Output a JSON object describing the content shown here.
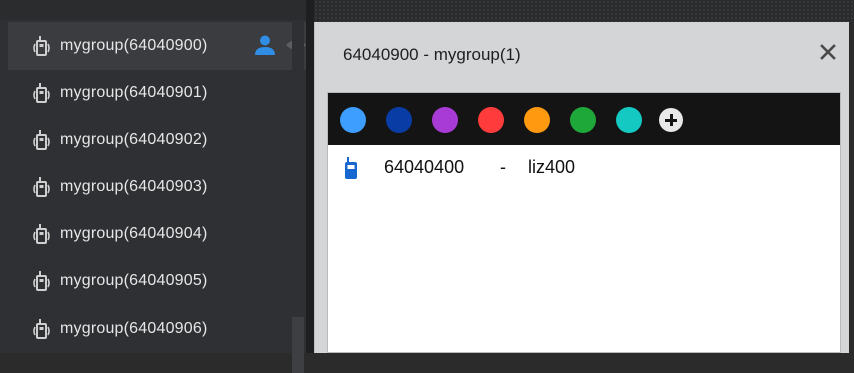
{
  "sidebar": {
    "groups": [
      {
        "label": "mygroup(64040900)"
      },
      {
        "label": "mygroup(64040901)"
      },
      {
        "label": "mygroup(64040902)"
      },
      {
        "label": "mygroup(64040903)"
      },
      {
        "label": "mygroup(64040904)"
      },
      {
        "label": "mygroup(64040905)"
      },
      {
        "label": "mygroup(64040906)"
      }
    ],
    "selected_index": 0
  },
  "dialog": {
    "title": "64040900 - mygroup(1)",
    "close_glyph": "✕",
    "colors": [
      "#3d9eff",
      "#0a3ca6",
      "#a83bd6",
      "#ff3b3b",
      "#ff9a10",
      "#1fa83a",
      "#14c9c2"
    ],
    "add_icon": "plus-circle-icon",
    "members": [
      {
        "id": "64040400",
        "separator": "-",
        "name": "liz400"
      }
    ]
  },
  "theme": {
    "accent": "#2f8de4",
    "radio_icon_color": "#cfcfcf"
  }
}
